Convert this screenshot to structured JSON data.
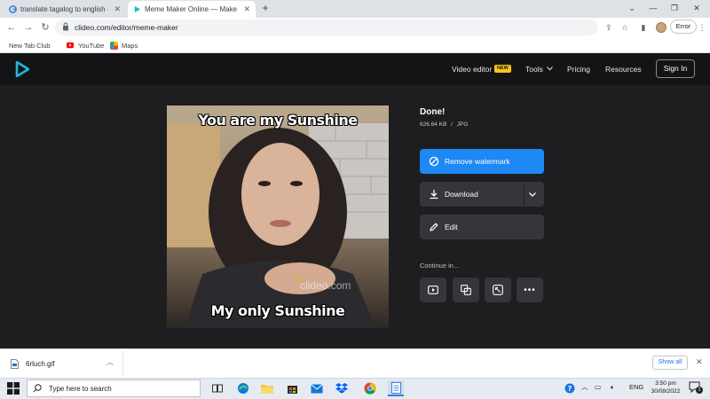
{
  "browser": {
    "tabs": [
      {
        "label": "translate tagalog to english - Go",
        "active": false
      },
      {
        "label": "Meme Maker Online — Make Yo",
        "active": true
      }
    ],
    "url": "clideo.com/editor/meme-maker",
    "error_label": "Error",
    "bookmarks": [
      {
        "label": "New Tab Club"
      },
      {
        "label": "YouTube"
      },
      {
        "label": "Maps"
      }
    ]
  },
  "site": {
    "nav": {
      "video_editor": "Video editor",
      "new_badge": "NEW",
      "tools": "Tools",
      "pricing": "Pricing",
      "resources": "Resources",
      "sign_in": "Sign In"
    },
    "meme": {
      "top_text": "You are my Sunshine",
      "bottom_text": "My only Sunshine",
      "watermark": "clideo.com"
    },
    "result": {
      "title": "Done!",
      "file_size": "626.64 KB",
      "separator": "/",
      "file_type": "JPG",
      "remove_watermark": "Remove watermark",
      "download": "Download",
      "edit": "Edit",
      "continue_in": "Continue in..."
    }
  },
  "download_shelf": {
    "filename": "6rluch.gif",
    "show_all": "Show all"
  },
  "taskbar": {
    "search_placeholder": "Type here to search",
    "language": "ENG",
    "time": "3:50 pm",
    "date": "30/08/2022",
    "notification_count": "2"
  },
  "colors": {
    "accent_blue": "#1e88f5",
    "clideo_logo": "#1fb8d8",
    "new_badge": "#f5c518"
  }
}
